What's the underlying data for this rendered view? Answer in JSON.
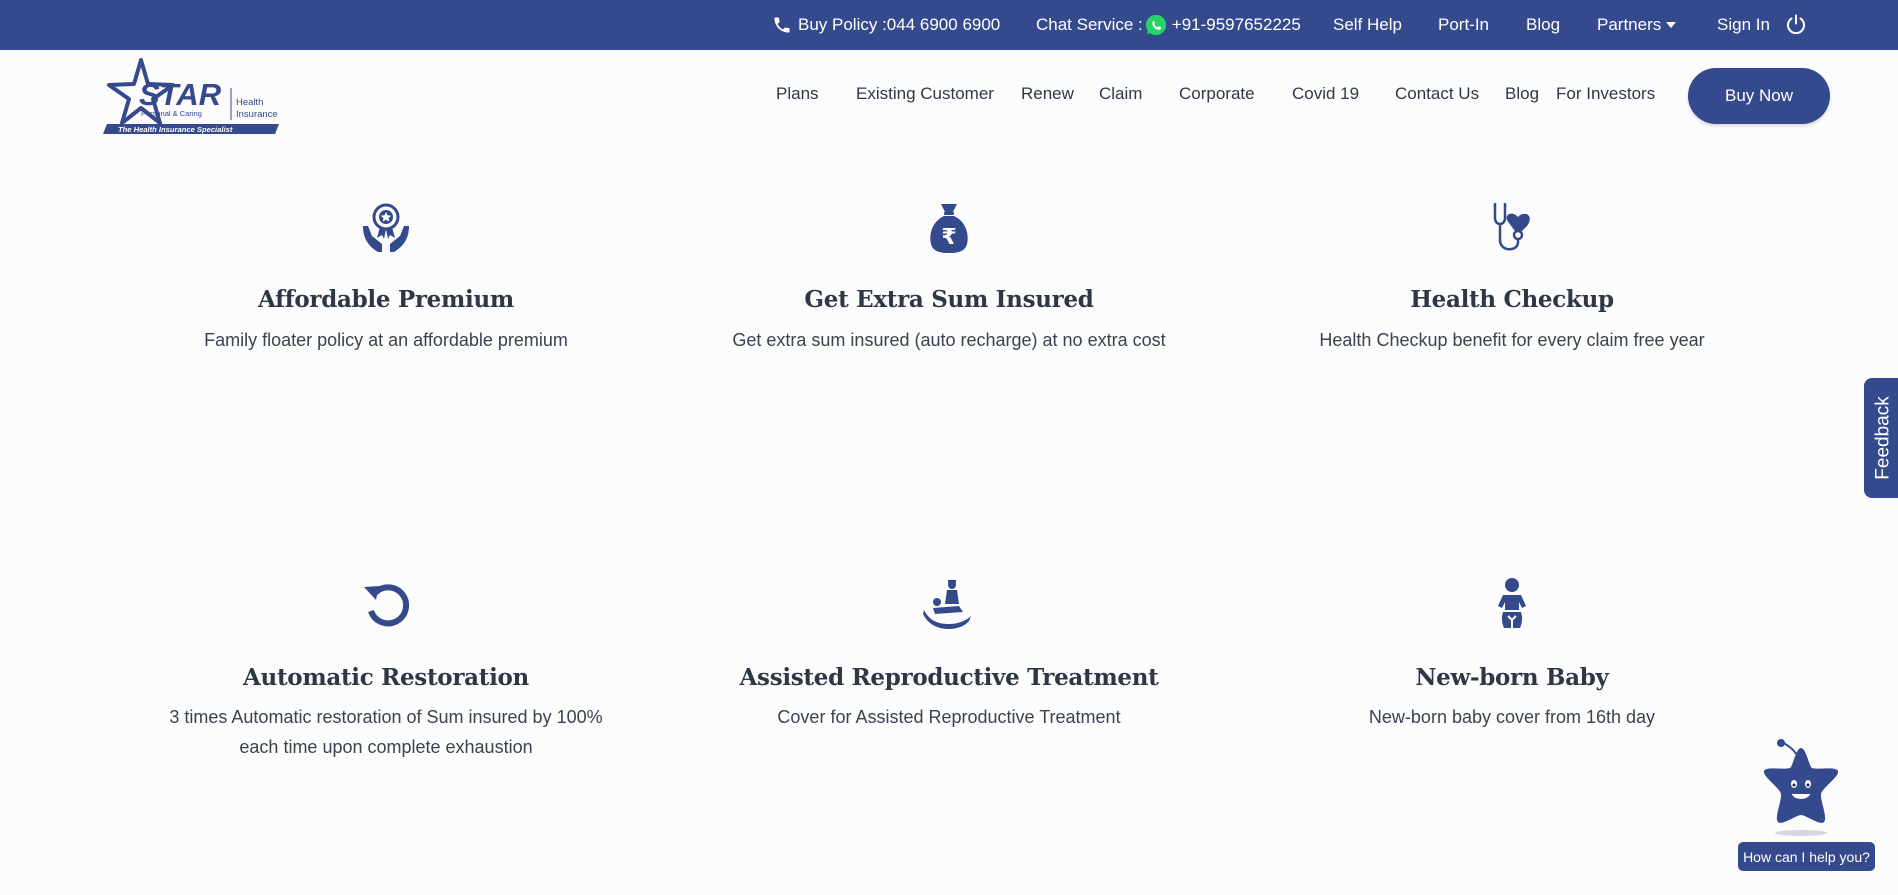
{
  "topbar": {
    "buy_policy": "Buy Policy :044 6900 6900",
    "chat_service_label": "Chat Service :",
    "chat_number": "+91-9597652225",
    "self_help": "Self Help",
    "port_in": "Port-In",
    "blog": "Blog",
    "partners": "Partners",
    "sign_in": "Sign In",
    "icons": [
      "phone-icon",
      "whatsapp-icon",
      "caret-down-icon",
      "power-icon"
    ]
  },
  "logo": {
    "name": "STAR",
    "health": "Health",
    "insurance": "Insurance",
    "sub": "Personal & Caring",
    "tagline": "The Health Insurance Specialist"
  },
  "nav": {
    "plans": "Plans",
    "existing_customer": "Existing Customer",
    "renew": "Renew",
    "claim": "Claim",
    "corporate": "Corporate",
    "covid": "Covid 19",
    "contact": "Contact Us",
    "blog": "Blog",
    "investors": "For Investors",
    "buy_now": "Buy Now"
  },
  "features": [
    {
      "icon": "award-hands-icon",
      "title": "Affordable Premium",
      "desc": "Family floater policy at an affordable premium"
    },
    {
      "icon": "rupee-bag-icon",
      "title": "Get Extra Sum Insured",
      "desc": "Get extra sum insured (auto recharge) at no extra cost"
    },
    {
      "icon": "stethoscope-heart-icon",
      "title": "Health Checkup",
      "desc": "Health Checkup benefit for every claim free year"
    },
    {
      "icon": "restore-icon",
      "title": "Automatic Restoration",
      "desc_line1": "3 times Automatic restoration of Sum insured by 100%",
      "desc_line2": "each time upon complete exhaustion"
    },
    {
      "icon": "reproductive-treatment-icon",
      "title": "Assisted Reproductive Treatment",
      "desc": "Cover for Assisted Reproductive Treatment"
    },
    {
      "icon": "baby-icon",
      "title": "New-born Baby",
      "desc": "New-born baby cover from 16th day"
    }
  ],
  "feedback": "Feedback",
  "chatbot": {
    "prompt": "How can I help you?"
  },
  "colors": {
    "primary": "#344a8d",
    "text": "#2f3744",
    "background": "#fcfcfd"
  }
}
